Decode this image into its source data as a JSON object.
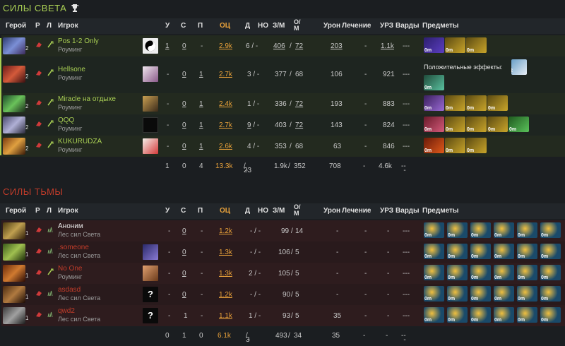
{
  "radiant": {
    "title": "Силы Света",
    "headers": {
      "hero": "Герой",
      "role": "Р",
      "lane": "Л",
      "player": "Игрок",
      "k": "У",
      "d": "С",
      "a": "П",
      "ocu": "ОЦ",
      "lh": "Д",
      "dn": "НО",
      "gpm": "З/М",
      "xpm": "О/М",
      "dmg": "Урон",
      "heal": "Лечение",
      "td": "УРЗ",
      "wards": "Варды",
      "items": "Предметы"
    },
    "rows": [
      {
        "name": "Pos 1-2 Only",
        "sub": "Роуминг",
        "lvl": "2",
        "k": "1",
        "d": "0",
        "a": "-",
        "ocu": "2.9k",
        "lh": "6",
        "dn": "-",
        "gpm": "406",
        "xpm": "72",
        "dmg": "203",
        "heal": "-",
        "td": "1.1k",
        "wards": "-",
        "items": [
          "0m",
          "0m",
          "0m"
        ]
      },
      {
        "name": "Hellsone",
        "sub": "Роуминг",
        "lvl": "2",
        "k": "-",
        "d": "0",
        "a": "1",
        "ocu": "2.7k",
        "lh": "3",
        "dn": "-",
        "gpm": "377",
        "xpm": "68",
        "dmg": "106",
        "heal": "-",
        "td": "921",
        "wards": "-",
        "items": [
          "0m"
        ],
        "buffs": "Положительные эффекты:",
        "buff_lvl": "2"
      },
      {
        "name": "Miracle на отдыхе",
        "sub": "Роуминг",
        "lvl": "2",
        "k": "-",
        "d": "0",
        "a": "1",
        "ocu": "2.4k",
        "lh": "1",
        "dn": "-",
        "gpm": "336",
        "xpm": "72",
        "dmg": "193",
        "heal": "-",
        "td": "883",
        "wards": "-",
        "items": [
          "0m",
          "0m",
          "0m",
          "0m"
        ]
      },
      {
        "name": "QQQ",
        "sub": "Роуминг",
        "lvl": "2",
        "k": "-",
        "d": "0",
        "a": "1",
        "ocu": "2.7k",
        "lh": "9",
        "dn": "-",
        "gpm": "403",
        "xpm": "72",
        "dmg": "143",
        "heal": "-",
        "td": "824",
        "wards": "-",
        "items": [
          "0m",
          "0m",
          "0m",
          "0m",
          "0m"
        ]
      },
      {
        "name": "KUKURUDZA",
        "sub": "Роуминг",
        "lvl": "2",
        "k": "-",
        "d": "0",
        "a": "1",
        "ocu": "2.6k",
        "lh": "4",
        "dn": "-",
        "gpm": "353",
        "xpm": "68",
        "dmg": "63",
        "heal": "-",
        "td": "846",
        "wards": "-",
        "items": [
          "0m",
          "0m",
          "0m"
        ]
      }
    ],
    "totals": {
      "k": "1",
      "d": "0",
      "a": "4",
      "ocu": "13.3k",
      "lh": "23",
      "dn": "-",
      "gpm": "1.9k",
      "xpm": "352",
      "dmg": "708",
      "heal": "-",
      "td": "4.6k",
      "wards": "-"
    }
  },
  "dire": {
    "title": "Силы Тьмы",
    "headers": {
      "hero": "Герой",
      "role": "Р",
      "lane": "Л",
      "player": "Игрок",
      "k": "У",
      "d": "С",
      "a": "П",
      "ocu": "ОЦ",
      "lh": "Д",
      "dn": "НО",
      "gpm": "З/М",
      "xpm": "О/М",
      "dmg": "Урон",
      "heal": "Лечение",
      "td": "УРЗ",
      "wards": "Варды",
      "items": "Предметы"
    },
    "rows": [
      {
        "name": "Аноним",
        "sub": "Лес сил Света",
        "lvl": "1",
        "k": "-",
        "d": "0",
        "a": "-",
        "ocu": "1.2k",
        "lh": "-",
        "dn": "-",
        "gpm": "99",
        "xpm": "14",
        "dmg": "-",
        "heal": "-",
        "td": "-",
        "wards": "-",
        "items": [
          "0m",
          "0m",
          "0m",
          "0m",
          "0m",
          "0m"
        ]
      },
      {
        "name": ".someone",
        "sub": "Лес сил Света",
        "lvl": "1",
        "k": "-",
        "d": "0",
        "a": "-",
        "ocu": "1.3k",
        "lh": "-",
        "dn": "-",
        "gpm": "106",
        "xpm": "5",
        "dmg": "-",
        "heal": "-",
        "td": "-",
        "wards": "-",
        "items": [
          "0m",
          "0m",
          "0m",
          "0m",
          "0m",
          "0m"
        ]
      },
      {
        "name": "No One",
        "sub": "Роуминг",
        "lvl": "1",
        "k": "-",
        "d": "0",
        "a": "-",
        "ocu": "1.3k",
        "lh": "2",
        "dn": "-",
        "gpm": "105",
        "xpm": "5",
        "dmg": "-",
        "heal": "-",
        "td": "-",
        "wards": "-",
        "items": [
          "0m",
          "0m",
          "0m",
          "0m",
          "0m",
          "0m"
        ]
      },
      {
        "name": "asdasd",
        "sub": "Лес сил Света",
        "lvl": "1",
        "k": "-",
        "d": "0",
        "a": "-",
        "ocu": "1.2k",
        "lh": "-",
        "dn": "-",
        "gpm": "90",
        "xpm": "5",
        "dmg": "-",
        "heal": "-",
        "td": "-",
        "wards": "-",
        "items": [
          "0m",
          "0m",
          "0m",
          "0m",
          "0m",
          "0m"
        ],
        "ava": "?"
      },
      {
        "name": "qwd2",
        "sub": "Лес сил Света",
        "lvl": "1",
        "k": "-",
        "d": "1",
        "a": "-",
        "ocu": "1.1k",
        "lh": "1",
        "dn": "-",
        "gpm": "93",
        "xpm": "5",
        "dmg": "35",
        "heal": "-",
        "td": "-",
        "wards": "-",
        "items": [
          "0m",
          "0m",
          "0m",
          "0m",
          "0m",
          "0m"
        ],
        "ava": "?"
      }
    ],
    "totals": {
      "k": "0",
      "d": "1",
      "a": "0",
      "ocu": "6.1k",
      "lh": "3",
      "dn": "-",
      "gpm": "493",
      "xpm": "34",
      "dmg": "35",
      "heal": "-",
      "td": "-",
      "wards": "-"
    }
  },
  "colors": {
    "radiant": "#a9cf54",
    "dire": "#c23c2a",
    "gold": "#e8a13a"
  }
}
